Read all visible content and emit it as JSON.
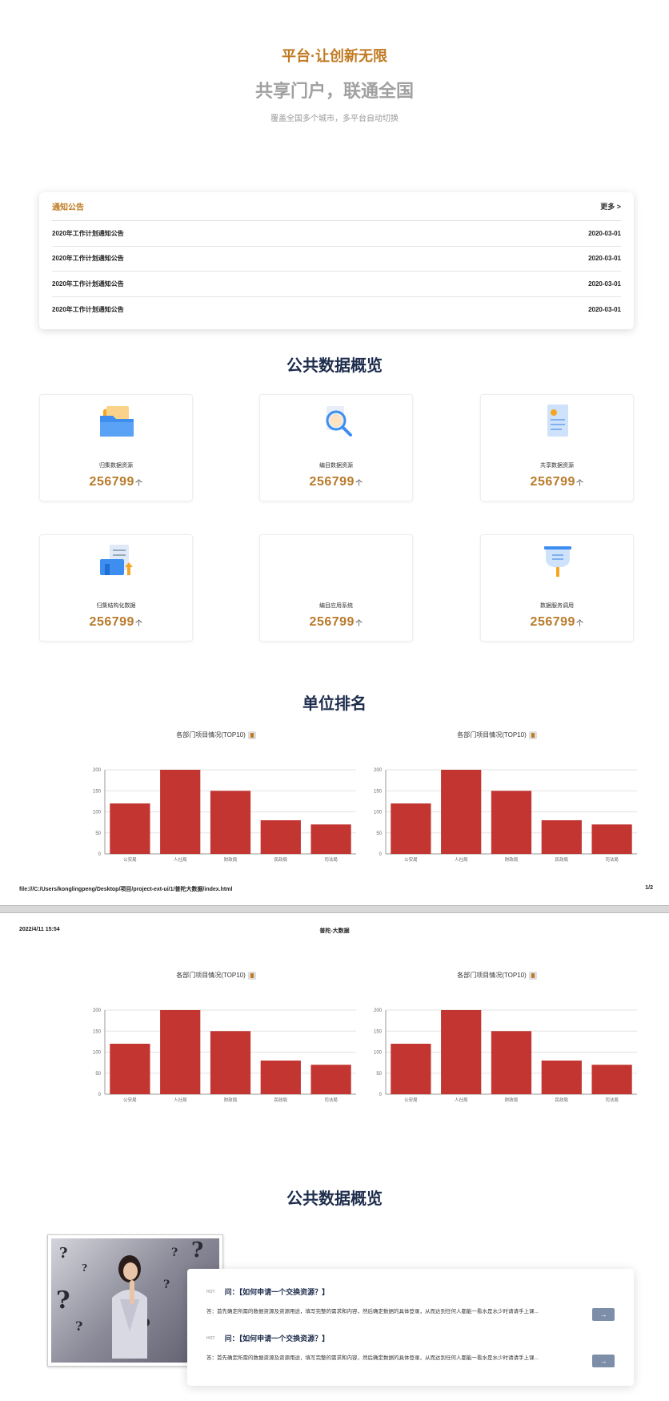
{
  "hero": {
    "title": "平台·让创新无限",
    "subtitle": "共享门户，联通全国",
    "desc": "覆盖全国多个城市，多平台自动切换"
  },
  "notice": {
    "title": "通知公告",
    "more": "更多 >",
    "items": [
      {
        "title": "2020年工作计划通知公告",
        "date": "2020-03-01"
      },
      {
        "title": "2020年工作计划通知公告",
        "date": "2020-03-01"
      },
      {
        "title": "2020年工作计划通知公告",
        "date": "2020-03-01"
      },
      {
        "title": "2020年工作计划通知公告",
        "date": "2020-03-01"
      }
    ]
  },
  "overview": {
    "title": "公共数据概览",
    "unit": "个",
    "cards": [
      {
        "label": "归集数据资源",
        "value": "256799",
        "icon": "folder-icon"
      },
      {
        "label": "编目数据资源",
        "value": "256799",
        "icon": "magnifier-icon"
      },
      {
        "label": "共享数据资源",
        "value": "256799",
        "icon": "id-card-icon"
      },
      {
        "label": "归集结构化数据",
        "value": "256799",
        "icon": "document-upload-icon"
      },
      {
        "label": "编目应用系统",
        "value": "256799",
        "icon": ""
      },
      {
        "label": "数据服务调用",
        "value": "256799",
        "icon": "funnel-icon"
      }
    ]
  },
  "ranking": {
    "title": "单位排名"
  },
  "footer": {
    "path": "file:///C:/Users/konglingpeng/Desktop/项目/project-ext-ui/1/普陀大数据/index.html",
    "page": "1/2"
  },
  "page2_header": {
    "time": "2022/4/11 15:54",
    "title": "普陀-大数据"
  },
  "overview2": {
    "title": "公共数据概览"
  },
  "faq": {
    "items": [
      {
        "hot": "HOT",
        "question": "问：【如何申请一个交换资源？】",
        "answer": "答：首先确定所需的数据资源及资源用途，填写完整的需求和内容，然后确定数据的具体登录，从而达到任何人都能一看水是水少时请请手上课..."
      },
      {
        "hot": "HOT",
        "question": "问：【如何申请一个交换资源？】",
        "answer": "答：首先确定所需的数据资源及资源用途，填写完整的需求和内容，然后确定数据的具体登录，从而达到任何人都能一看水是水少时请请手上课..."
      }
    ],
    "arrow": "→"
  },
  "colors": {
    "accent": "#c07a22",
    "bar": "#c23531",
    "title": "#1f2d4d"
  },
  "chart_data": [
    {
      "type": "bar",
      "title": "各部门项目情况(TOP10)",
      "categories": [
        "公安局",
        "人社局",
        "财政局",
        "民政局",
        "司法局"
      ],
      "values": [
        120,
        200,
        150,
        80,
        70
      ],
      "ylim": [
        0,
        200
      ],
      "yticks": [
        0,
        50,
        100,
        150,
        200
      ],
      "grid": true
    },
    {
      "type": "bar",
      "title": "各部门项目情况(TOP10)",
      "categories": [
        "公安局",
        "人社局",
        "财政局",
        "民政局",
        "司法局"
      ],
      "values": [
        120,
        200,
        150,
        80,
        70
      ],
      "ylim": [
        0,
        200
      ],
      "yticks": [
        0,
        50,
        100,
        150,
        200
      ],
      "grid": true
    },
    {
      "type": "bar",
      "title": "各部门项目情况(TOP10)",
      "categories": [
        "公安局",
        "人社局",
        "财政局",
        "民政局",
        "司法局"
      ],
      "values": [
        120,
        200,
        150,
        80,
        70
      ],
      "ylim": [
        0,
        200
      ],
      "yticks": [
        0,
        50,
        100,
        150,
        200
      ],
      "grid": true
    },
    {
      "type": "bar",
      "title": "各部门项目情况(TOP10)",
      "categories": [
        "公安局",
        "人社局",
        "财政局",
        "民政局",
        "司法局"
      ],
      "values": [
        120,
        200,
        150,
        80,
        70
      ],
      "ylim": [
        0,
        200
      ],
      "yticks": [
        0,
        50,
        100,
        150,
        200
      ],
      "grid": true
    }
  ]
}
